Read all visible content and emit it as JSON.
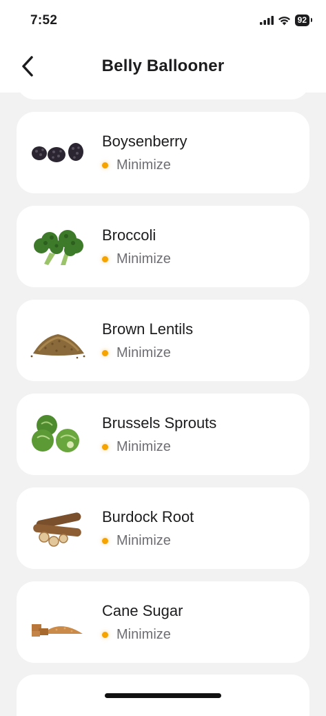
{
  "status_bar": {
    "time": "7:52",
    "battery": "92"
  },
  "nav": {
    "title": "Belly Ballooner"
  },
  "items": [
    {
      "name": "Boysenberry",
      "rating": "Minimize",
      "image": "boysenberry-image"
    },
    {
      "name": "Broccoli",
      "rating": "Minimize",
      "image": "broccoli-image"
    },
    {
      "name": "Brown Lentils",
      "rating": "Minimize",
      "image": "brown-lentils-image"
    },
    {
      "name": "Brussels Sprouts",
      "rating": "Minimize",
      "image": "brussels-sprouts-image"
    },
    {
      "name": "Burdock Root",
      "rating": "Minimize",
      "image": "burdock-root-image"
    },
    {
      "name": "Cane Sugar",
      "rating": "Minimize",
      "image": "cane-sugar-image"
    }
  ],
  "colors": {
    "rating_dot": "#f5a300",
    "background": "#f2f2f2",
    "card": "#ffffff"
  }
}
